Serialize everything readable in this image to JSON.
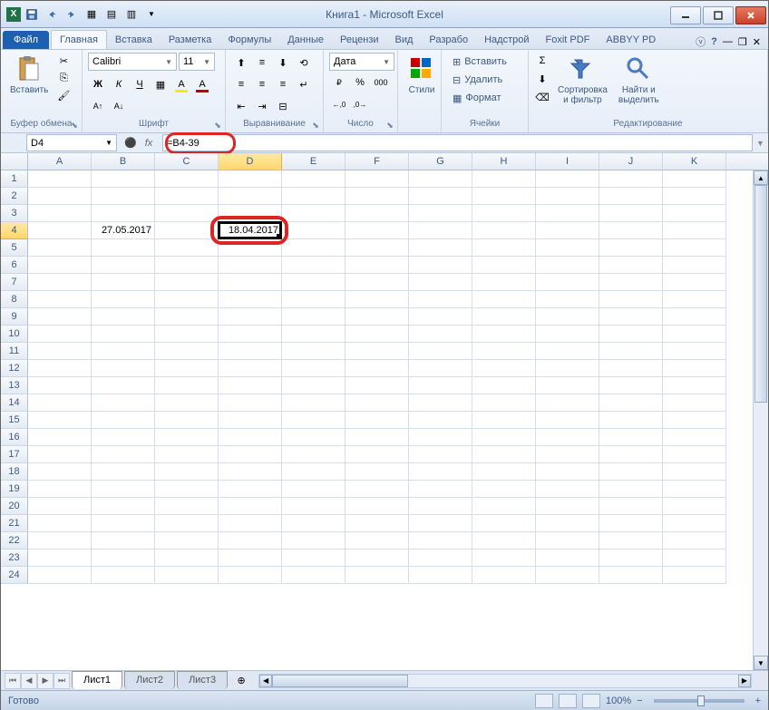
{
  "title": "Книга1 - Microsoft Excel",
  "qat": {
    "save": "💾",
    "undo": "↶",
    "redo": "↷"
  },
  "tabs": {
    "file": "Файл",
    "items": [
      "Главная",
      "Вставка",
      "Разметка",
      "Формулы",
      "Данные",
      "Рецензи",
      "Вид",
      "Разрабо",
      "Надстрой",
      "Foxit PDF",
      "ABBYY PD"
    ],
    "active_index": 0
  },
  "ribbon": {
    "clipboard": {
      "label": "Буфер обмена",
      "paste": "Вставить"
    },
    "font": {
      "label": "Шрифт",
      "name": "Calibri",
      "size": "11"
    },
    "align": {
      "label": "Выравнивание"
    },
    "number": {
      "label": "Число",
      "format": "Дата"
    },
    "styles": {
      "label": "",
      "btn": "Стили"
    },
    "cells": {
      "label": "Ячейки",
      "insert": "Вставить",
      "delete": "Удалить",
      "format": "Формат"
    },
    "editing": {
      "label": "Редактирование",
      "sort": "Сортировка\nи фильтр",
      "find": "Найти и\nвыделить"
    }
  },
  "namebox": "D4",
  "formula": "=B4-39",
  "columns": [
    "A",
    "B",
    "C",
    "D",
    "E",
    "F",
    "G",
    "H",
    "I",
    "J",
    "K"
  ],
  "rows_count": 24,
  "selected_col": "D",
  "selected_row": 4,
  "cells": {
    "B4": "27.05.2017",
    "D4": "18.04.2017"
  },
  "sheets": {
    "active": "Лист1",
    "tabs": [
      "Лист1",
      "Лист2",
      "Лист3"
    ]
  },
  "status": {
    "ready": "Готово",
    "zoom": "100%"
  }
}
